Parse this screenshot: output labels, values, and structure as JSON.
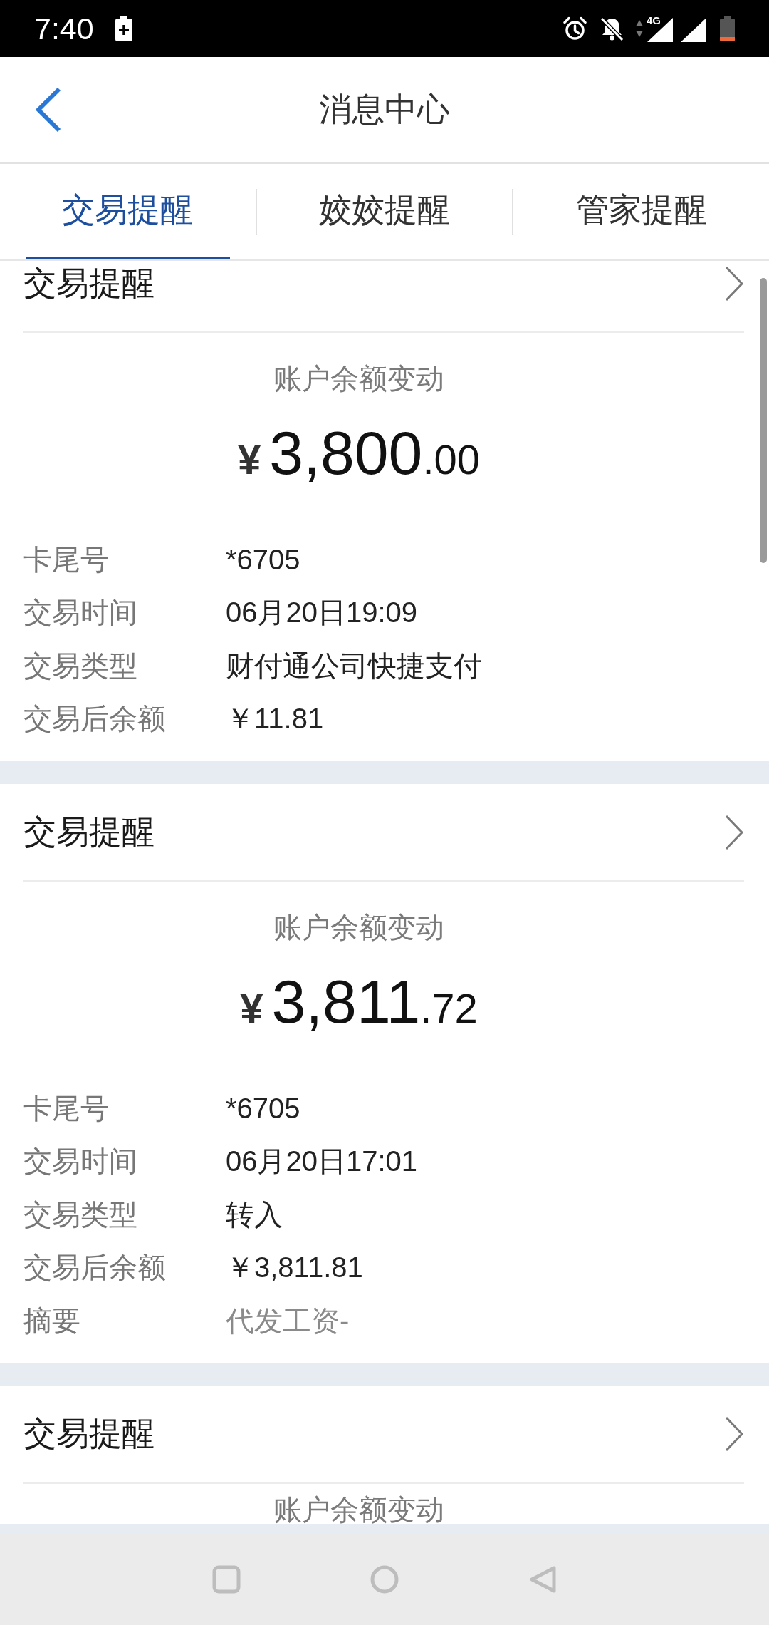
{
  "status_bar": {
    "time": "7:40",
    "network": "4G"
  },
  "header": {
    "title": "消息中心"
  },
  "tabs": [
    {
      "label": "交易提醒",
      "selected": true
    },
    {
      "label": "姣姣提醒",
      "selected": false
    },
    {
      "label": "管家提醒",
      "selected": false
    }
  ],
  "messages": [
    {
      "title": "交易提醒",
      "subtitle": "账户余额变动",
      "amount": {
        "currency": "¥",
        "integer": "3,800",
        "decimals": ".00"
      },
      "details": [
        {
          "label": "卡尾号",
          "value": "*6705",
          "kind": "text"
        },
        {
          "label": "交易时间",
          "value": "06月20日19:09",
          "kind": "text"
        },
        {
          "label": "交易类型",
          "value": "财付通公司快捷支付",
          "kind": "text"
        },
        {
          "label": "交易后余额",
          "value": "￥11.81",
          "kind": "text"
        }
      ]
    },
    {
      "title": "交易提醒",
      "subtitle": "账户余额变动",
      "amount": {
        "currency": "¥",
        "integer": "3,811",
        "decimals": ".72"
      },
      "details": [
        {
          "label": "卡尾号",
          "value": "*6705",
          "kind": "text"
        },
        {
          "label": "交易时间",
          "value": "06月20日17:01",
          "kind": "text"
        },
        {
          "label": "交易类型",
          "value": "转入",
          "kind": "text"
        },
        {
          "label": "交易后余额",
          "value": "￥3,811.81",
          "kind": "text"
        },
        {
          "label": "摘要",
          "value": "代发工资-",
          "kind": "remark"
        }
      ]
    },
    {
      "title": "交易提醒",
      "subtitle": "账户余额变动"
    }
  ]
}
